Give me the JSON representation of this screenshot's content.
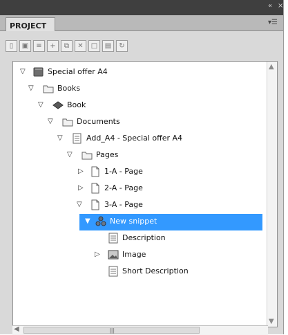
{
  "panel": {
    "title": "PROJECT",
    "titlebar_controls": [
      "«",
      "×"
    ],
    "menu_icon": "panel-menu-icon"
  },
  "toolbar": {
    "buttons": [
      {
        "name": "new-project-button",
        "icon": "page-icon"
      },
      {
        "name": "save-button",
        "icon": "disk-icon"
      },
      {
        "name": "properties-button",
        "icon": "list-icon"
      },
      {
        "name": "add-button",
        "icon": "plus-icon"
      },
      {
        "name": "duplicate-button",
        "icon": "copy-icon"
      },
      {
        "name": "delete-button",
        "icon": "x-icon"
      },
      {
        "name": "new-snippet-button",
        "icon": "doc-icon"
      },
      {
        "name": "view-button",
        "icon": "window-icon"
      },
      {
        "name": "refresh-button",
        "icon": "refresh-icon"
      }
    ]
  },
  "tree": [
    {
      "label": "Special offer A4",
      "icon": "book-closed-icon",
      "expanded": true,
      "selected": false
    },
    {
      "label": "Books",
      "icon": "folder-icon",
      "expanded": true,
      "selected": false
    },
    {
      "label": "Book",
      "icon": "book-icon",
      "expanded": true,
      "selected": false
    },
    {
      "label": "Documents",
      "icon": "folder-icon",
      "expanded": true,
      "selected": false
    },
    {
      "label": "Add_A4 - Special offer A4",
      "icon": "document-icon",
      "expanded": true,
      "selected": false
    },
    {
      "label": "Pages",
      "icon": "folder-icon",
      "expanded": true,
      "selected": false
    },
    {
      "label": "1-A - Page",
      "icon": "page-icon",
      "expanded": false,
      "selected": false
    },
    {
      "label": "2-A - Page",
      "icon": "page-icon",
      "expanded": false,
      "selected": false
    },
    {
      "label": "3-A - Page",
      "icon": "page-icon",
      "expanded": true,
      "selected": false
    },
    {
      "label": "New snippet",
      "icon": "snippet-icon",
      "expanded": true,
      "selected": true
    },
    {
      "label": "Description",
      "icon": "text-field-icon",
      "expanded": null,
      "selected": false
    },
    {
      "label": "Image",
      "icon": "image-icon",
      "expanded": false,
      "selected": false
    },
    {
      "label": "Short Description",
      "icon": "text-field-icon",
      "expanded": null,
      "selected": false
    }
  ],
  "colors": {
    "selection": "#3399ff",
    "titlebar": "#3f3f3f",
    "panel_bg": "#d9d9d9"
  }
}
